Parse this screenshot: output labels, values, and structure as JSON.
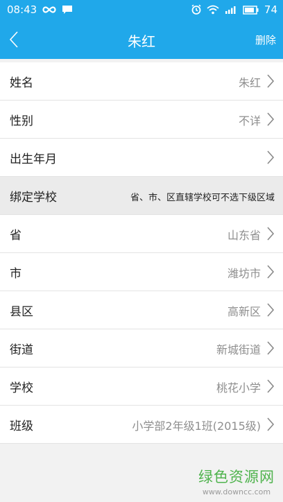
{
  "status_bar": {
    "time": "08:43",
    "battery": "74",
    "icons": [
      "infinity-icon",
      "message-icon",
      "alarm-icon",
      "wifi-icon",
      "signal-icon",
      "battery-icon"
    ]
  },
  "header": {
    "title": "朱红",
    "delete_label": "删除",
    "back_icon": "chevron-left-icon"
  },
  "rows": [
    {
      "label": "姓名",
      "value": "朱红"
    },
    {
      "label": "性别",
      "value": "不详"
    },
    {
      "label": "出生年月",
      "value": ""
    },
    {
      "label": "绑定学校",
      "note": "省、市、区直辖学校可不选下级区域"
    },
    {
      "label": "省",
      "value": "山东省"
    },
    {
      "label": "市",
      "value": "潍坊市"
    },
    {
      "label": "县区",
      "value": "高新区"
    },
    {
      "label": "街道",
      "value": "新城街道"
    },
    {
      "label": "学校",
      "value": "桃花小学"
    },
    {
      "label": "班级",
      "value": "小学部2年级1班(2015级)"
    }
  ],
  "watermark": {
    "title": "绿色资源网",
    "url": "www.downcc.com"
  },
  "colors": {
    "accent": "#20a8ea",
    "section_bg": "#ebebeb",
    "value_text": "#8e8e8e",
    "watermark_green": "#4fb34d"
  }
}
